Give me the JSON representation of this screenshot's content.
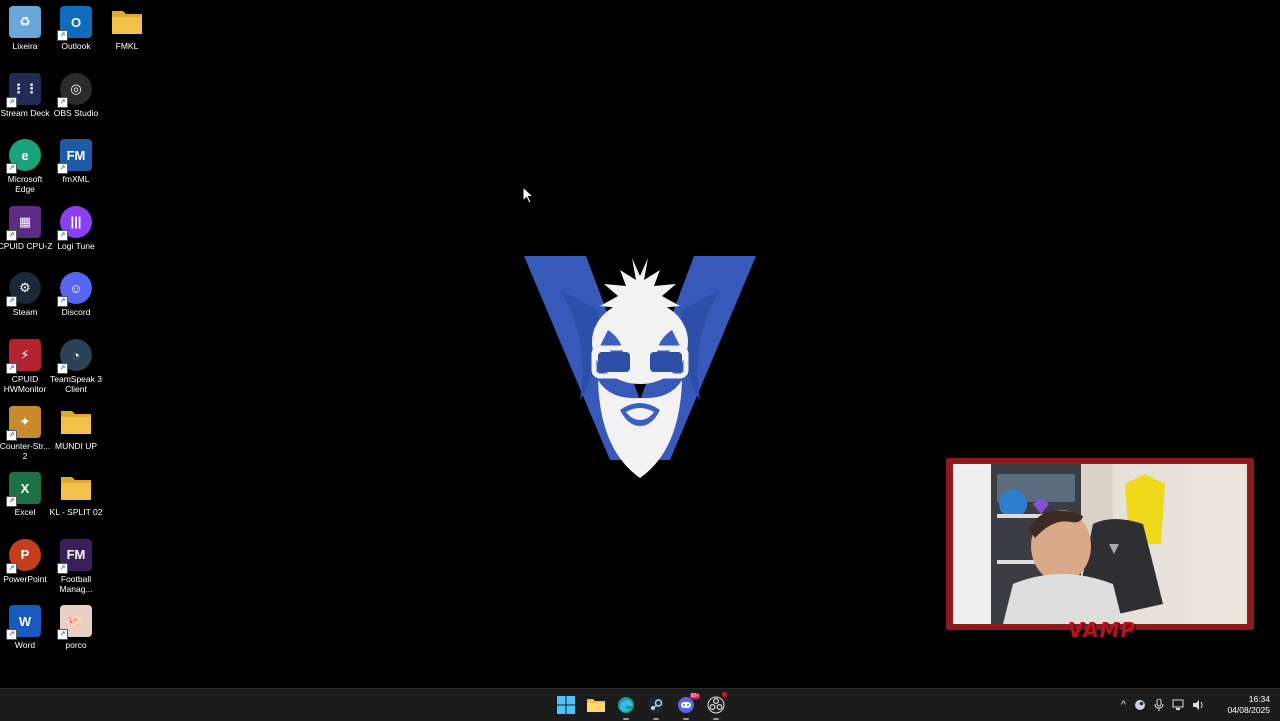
{
  "desktop_icons": [
    {
      "label": "Lixeira",
      "icon": "recycle-bin-icon",
      "color": "#6aa7d8"
    },
    {
      "label": "Outlook",
      "icon": "outlook-icon",
      "color": "#0f6cbd"
    },
    {
      "label": "FMKL",
      "icon": "folder-icon",
      "color": "#f3c04b"
    },
    {
      "label": "Stream Deck",
      "icon": "stream-deck-icon",
      "color": "#222a55"
    },
    {
      "label": "OBS Studio",
      "icon": "obs-studio-icon",
      "color": "#2b2b2b"
    },
    {
      "label": "Microsoft Edge",
      "icon": "edge-icon",
      "color": "#1aa37a"
    },
    {
      "label": "fmXML",
      "icon": "fmxml-icon",
      "color": "#1e5aa8"
    },
    {
      "label": "CPUID CPU-Z",
      "icon": "cpu-z-icon",
      "color": "#5b2b86"
    },
    {
      "label": "Logi Tune",
      "icon": "logi-tune-icon",
      "color": "#8a3ff0"
    },
    {
      "label": "Steam",
      "icon": "steam-icon",
      "color": "#1b2838"
    },
    {
      "label": "Discord",
      "icon": "discord-icon",
      "color": "#5865f2"
    },
    {
      "label": "CPUID HWMonitor",
      "icon": "hwmonitor-icon",
      "color": "#b2232f"
    },
    {
      "label": "TeamSpeak 3 Client",
      "icon": "teamspeak-icon",
      "color": "#2c4256"
    },
    {
      "label": "Counter-Str... 2",
      "icon": "counter-strike-icon",
      "color": "#c88a2a"
    },
    {
      "label": "MUNDI UP",
      "icon": "folder-icon",
      "color": "#f3c04b"
    },
    {
      "label": "Excel",
      "icon": "excel-icon",
      "color": "#1e7145"
    },
    {
      "label": "KL - SPLIT 02",
      "icon": "folder-icon",
      "color": "#f3c04b"
    },
    {
      "label": "PowerPoint",
      "icon": "powerpoint-icon",
      "color": "#c43e1c"
    },
    {
      "label": "Football Manag...",
      "icon": "football-manager-icon",
      "color": "#3a1f5c"
    },
    {
      "label": "Word",
      "icon": "word-icon",
      "color": "#185abd"
    },
    {
      "label": "porco",
      "icon": "pig-image-icon",
      "color": "#e9cfc4"
    }
  ],
  "webcam": {
    "label": "VAMP",
    "border_color": "#8e1a20"
  },
  "taskbar": {
    "apps": [
      {
        "icon": "windows-start-icon",
        "name": "start"
      },
      {
        "icon": "file-explorer-icon",
        "name": "file-explorer"
      },
      {
        "icon": "edge-icon",
        "name": "edge"
      },
      {
        "icon": "steam-icon",
        "name": "steam"
      },
      {
        "icon": "discord-icon",
        "name": "discord",
        "badge": "99+"
      },
      {
        "icon": "obs-studio-icon",
        "name": "obs"
      }
    ],
    "tray": {
      "chevron": "^"
    },
    "clock": {
      "time": "16:34",
      "date": "04/08/2025"
    }
  }
}
